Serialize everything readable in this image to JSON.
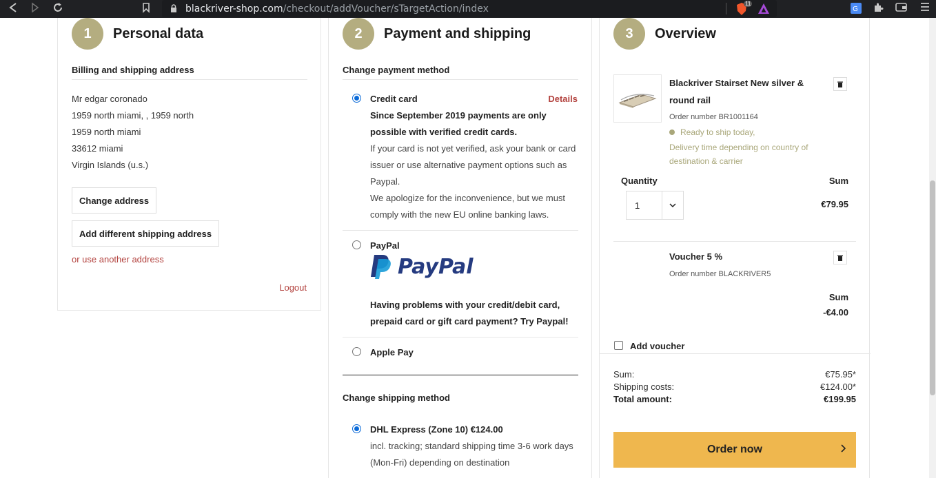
{
  "browser": {
    "url_host": "blackriver-shop.com",
    "url_path": "/checkout/addVoucher/sTargetAction/index",
    "brave_badge": "11"
  },
  "steps": [
    {
      "number": "1",
      "title": "Personal data"
    },
    {
      "number": "2",
      "title": "Payment and shipping"
    },
    {
      "number": "3",
      "title": "Overview"
    }
  ],
  "personal": {
    "heading": "Billing and shipping address",
    "address_lines": [
      "Mr edgar coronado",
      "1959 north miami, , 1959 north",
      "1959 north miami",
      "33612 miami",
      "Virgin Islands (u.s.)"
    ],
    "change_address": "Change address",
    "add_shipping": "Add different shipping address",
    "other_address": "or use another address",
    "logout": "Logout"
  },
  "payment": {
    "heading": "Change payment method",
    "credit_card": {
      "label": "Credit card",
      "details": "Details",
      "notice_bold_1": "Since September 2019 payments are only",
      "notice_bold_2": "possible with verified credit cards.",
      "text_1": "If your card is not yet verified, ask your bank or card",
      "text_2": "issuer or use alternative payment options such as",
      "text_3": "Paypal.",
      "text_4": "We apologize for the inconvenience, but we must",
      "text_5": "comply with the new EU online banking laws."
    },
    "paypal": {
      "label": "PayPal",
      "logo_text": "PayPal",
      "note_1": "Having problems with your credit/debit card,",
      "note_2": "prepaid card or gift card payment? Try Paypal!"
    },
    "apple_pay": {
      "label": "Apple Pay"
    }
  },
  "shipping": {
    "heading": "Change shipping method",
    "option_label": "DHL Express (Zone 10) €124.00",
    "desc_1": "incl. tracking; standard shipping time 3-6 work days",
    "desc_2": "(Mon-Fri) depending on destination"
  },
  "overview": {
    "product": {
      "name_1": "Blackriver Stairset New silver &",
      "name_2": "round rail",
      "order_number": "Order number BR1001164",
      "ship_status": "Ready to ship today,",
      "delivery_1": "Delivery time depending on country of",
      "delivery_2": "destination & carrier"
    },
    "quantity_label": "Quantity",
    "sum_label": "Sum",
    "quantity_value": "1",
    "product_sum": "€79.95",
    "voucher": {
      "name": "Voucher 5 %",
      "order_number": "Order number BLACKRIVER5",
      "sum_label": "Sum",
      "sum_value": "-€4.00"
    },
    "add_voucher": "Add voucher",
    "totals": {
      "sum_label": "Sum:",
      "sum_value": "€75.95*",
      "shipping_label": "Shipping costs:",
      "shipping_value": "€124.00*",
      "total_label": "Total amount:",
      "total_value": "€199.95"
    },
    "order_button": "Order now"
  },
  "colors": {
    "step_circle": "#b4ad80",
    "accent_red": "#b3433f",
    "order_button": "#efb74e",
    "radio_blue": "#0a6ad8",
    "paypal_dark": "#253b80",
    "paypal_light": "#179bd7"
  }
}
